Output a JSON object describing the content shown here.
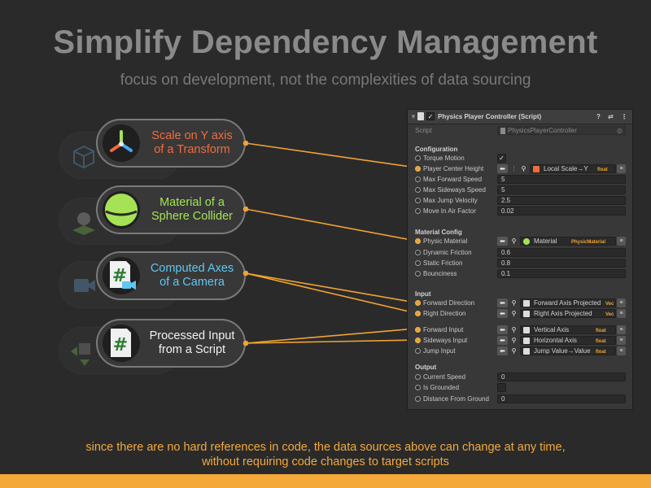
{
  "heading": {
    "title": "Simplify Dependency Management",
    "subtitle": "focus on development, not the complexities of data sourcing"
  },
  "callouts": [
    {
      "line1": "Scale on Y axis",
      "line2": "of a Transform",
      "color": "#f26b3a",
      "icon": "transform-axes-icon"
    },
    {
      "line1": "Material of a",
      "line2": "Sphere Collider",
      "color": "#a5e255",
      "icon": "sphere-icon"
    },
    {
      "line1": "Computed Axes",
      "line2": "of a Camera",
      "color": "#5fc7f0",
      "icon": "script-camera-icon"
    },
    {
      "line1": "Processed Input",
      "line2": "from a Script",
      "color": "#f0f0f0",
      "icon": "script-icon"
    }
  ],
  "inspector": {
    "component_title": "Physics Player Controller (Script)",
    "script_label": "Script",
    "script_value": "PhysicsPlayerController",
    "sections": {
      "configuration": "Configuration",
      "material_config": "Material Config",
      "input": "Input",
      "output": "Output"
    },
    "configuration": {
      "torque_motion": {
        "label": "Torque Motion",
        "checked": true,
        "check": "✓"
      },
      "player_center_height": {
        "label": "Player Center Height",
        "ref": "Local Scale→Y",
        "tag": "float"
      },
      "max_forward_speed": {
        "label": "Max Forward Speed",
        "value": "5"
      },
      "max_sideways_speed": {
        "label": "Max Sideways Speed",
        "value": "5"
      },
      "max_jump_velocity": {
        "label": "Max Jump Velocity",
        "value": "2.5"
      },
      "move_in_air_factor": {
        "label": "Move In Air Factor",
        "value": "0.02"
      }
    },
    "material_config": {
      "physic_material": {
        "label": "Physic Material",
        "ref": "Material",
        "tag": "PhysicMaterial"
      },
      "dynamic_friction": {
        "label": "Dynamic Friction",
        "value": "0.6"
      },
      "static_friction": {
        "label": "Static Friction",
        "value": "0.8"
      },
      "bounciness": {
        "label": "Bounciness",
        "value": "0.1"
      }
    },
    "input": {
      "forward_direction": {
        "label": "Forward Direction",
        "ref": "Forward Axis Projected",
        "tag": "Vec"
      },
      "right_direction": {
        "label": "Right Direction",
        "ref": "Right Axis Projected",
        "tag": "Vec"
      },
      "forward_input": {
        "label": "Forward Input",
        "ref": "Vertical Axis",
        "tag": "float"
      },
      "sideways_input": {
        "label": "Sideways Input",
        "ref": "Horizontal Axis",
        "tag": "float"
      },
      "jump_input": {
        "label": "Jump Input",
        "ref": "Jump Value→Value",
        "tag": "float"
      }
    },
    "output": {
      "current_speed": {
        "label": "Current Speed",
        "value": "0"
      },
      "is_grounded": {
        "label": "Is Grounded",
        "checked": false
      },
      "distance_from_ground": {
        "label": "Distance From Ground",
        "value": "0"
      }
    }
  },
  "footer": {
    "line1": "since there are no hard references in code, the data sources above can change at any time,",
    "line2": "without requiring code changes to target scripts"
  },
  "colors": {
    "accent": "#f3a838",
    "connector": "#f0a332",
    "background": "#2a2a2a"
  }
}
